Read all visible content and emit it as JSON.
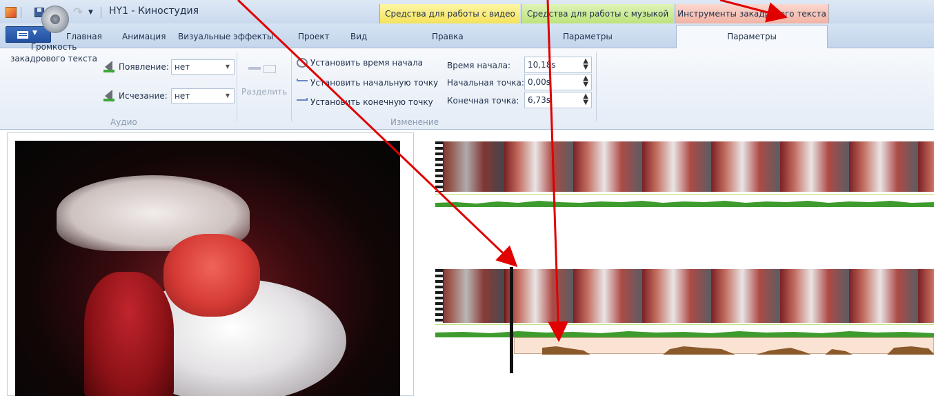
{
  "window": {
    "title": "HY1 - Киностудия"
  },
  "context_groups": {
    "video_tools": "Средства для работы с видео",
    "music_tools": "Средства для работы с музыкой",
    "narration_tools": "Инструменты закадрового текста"
  },
  "tabs": {
    "home": "Главная",
    "animation": "Анимация",
    "visual_effects": "Визуальные эффекты",
    "project": "Проект",
    "view": "Вид",
    "edit": "Правка",
    "music_params": "Параметры",
    "narration_params": "Параметры"
  },
  "ribbon": {
    "volume_label": "Громкость\nзакадрового текста",
    "fade_in_label": "Появление:",
    "fade_in_value": "нет",
    "fade_out_label": "Исчезание:",
    "fade_out_value": "нет",
    "split_label": "Разделить",
    "set_start_time": "Установить время начала",
    "set_start_point": "Установить начальную точку",
    "set_end_point": "Установить конечную точку",
    "start_time_label": "Время начала:",
    "start_time_value": "10,18s",
    "start_point_label": "Начальная точка:",
    "start_point_value": "0,00s",
    "end_point_label": "Конечная точка:",
    "end_point_value": "6,73s",
    "group_audio": "Аудио",
    "group_edit": "Изменение"
  },
  "icons": {
    "app": "movie-maker-icon",
    "save": "save-icon",
    "undo": "undo-icon",
    "redo": "redo-icon"
  },
  "colors": {
    "video_context": "#f4e25a",
    "music_context": "#bde37a",
    "narration_context": "#f2b3a4",
    "annotation_arrow": "#e00000",
    "music_wave": "#3e9b2d",
    "narration_wave": "#8b5a2b"
  }
}
